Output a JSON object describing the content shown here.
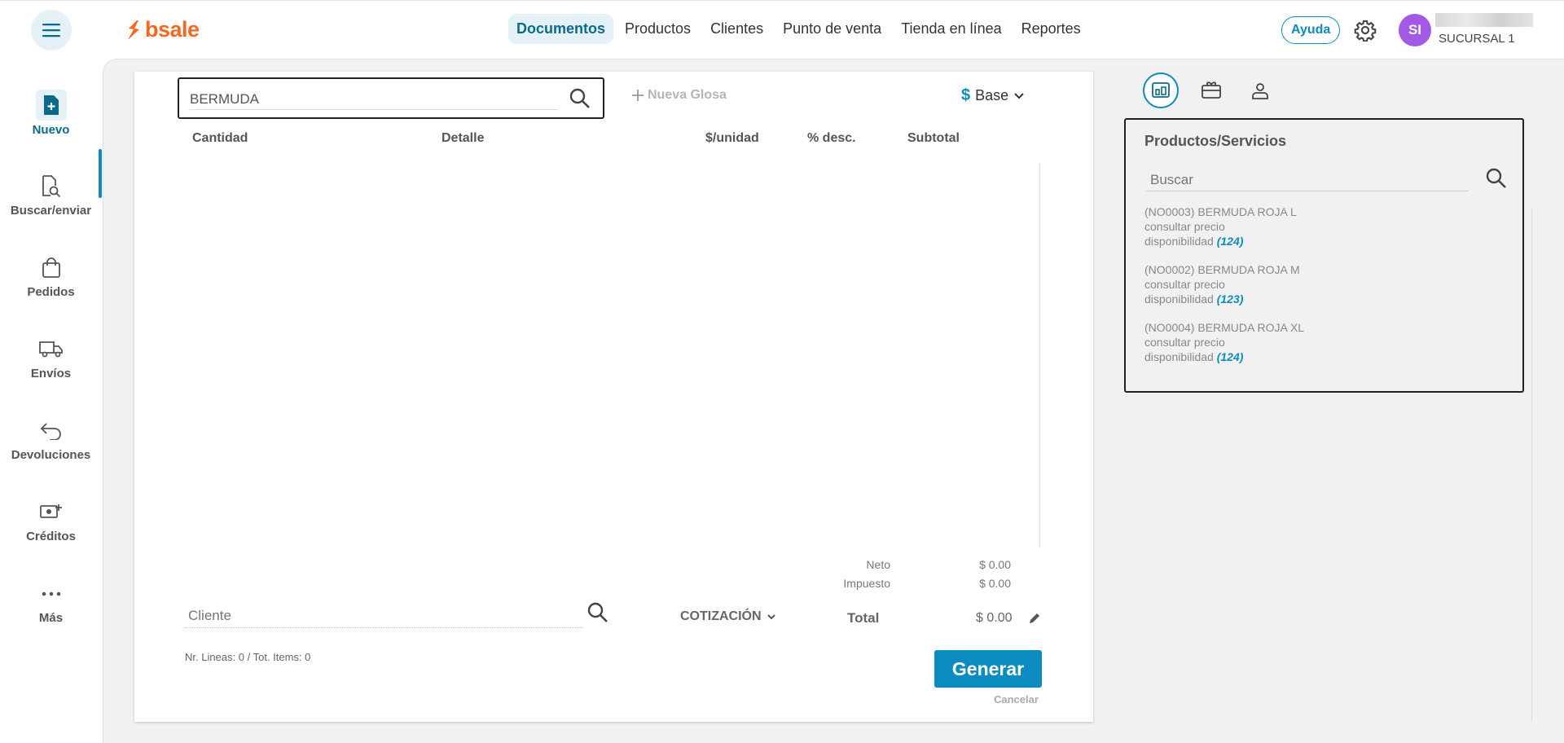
{
  "header": {
    "logo": "bsale",
    "nav": [
      "Documentos",
      "Productos",
      "Clientes",
      "Punto de venta",
      "Tienda en línea",
      "Reportes"
    ],
    "help_label": "Ayuda",
    "avatar_initials": "SI",
    "branch": "SUCURSAL 1"
  },
  "sidebar": {
    "items": [
      {
        "label": "Nuevo",
        "icon": "new-document-icon"
      },
      {
        "label": "Buscar/enviar",
        "icon": "search-document-icon"
      },
      {
        "label": "Pedidos",
        "icon": "shopping-bag-icon"
      },
      {
        "label": "Envíos",
        "icon": "truck-icon"
      },
      {
        "label": "Devoluciones",
        "icon": "return-arrow-icon"
      },
      {
        "label": "Créditos",
        "icon": "money-add-icon"
      },
      {
        "label": "Más",
        "icon": "more-dots-icon"
      }
    ]
  },
  "document": {
    "search_value": "BERMUDA",
    "nueva_glosa": "Nueva Glosa",
    "price_list": "Base",
    "columns": [
      "Cantidad",
      "Detalle",
      "$/unidad",
      "% desc.",
      "Subtotal"
    ],
    "neto_label": "Neto",
    "neto_value": "$ 0.00",
    "impuesto_label": "Impuesto",
    "impuesto_value": "$ 0.00",
    "cliente_placeholder": "Cliente",
    "doc_type": "COTIZACIÓN",
    "total_label": "Total",
    "total_value": "$ 0.00",
    "lines_info": "Nr. Lineas: 0 / Tot. Items: 0",
    "generate_label": "Generar",
    "cancel_label": "Cancelar"
  },
  "products_panel": {
    "title": "Productos/Servicios",
    "search_placeholder": "Buscar",
    "items": [
      {
        "name": "(NO0003) BERMUDA ROJA L",
        "price": "consultar precio",
        "availability_label": "disponibilidad",
        "availability": "(124)"
      },
      {
        "name": "(NO0002) BERMUDA ROJA M",
        "price": "consultar precio",
        "availability_label": "disponibilidad",
        "availability": "(123)"
      },
      {
        "name": "(NO0004) BERMUDA ROJA XL",
        "price": "consultar precio",
        "availability_label": "disponibilidad",
        "availability": "(124)"
      }
    ]
  },
  "colors": {
    "brand": "#f26a21",
    "accent": "#0b8bc0",
    "avatar": "#a259e6"
  }
}
